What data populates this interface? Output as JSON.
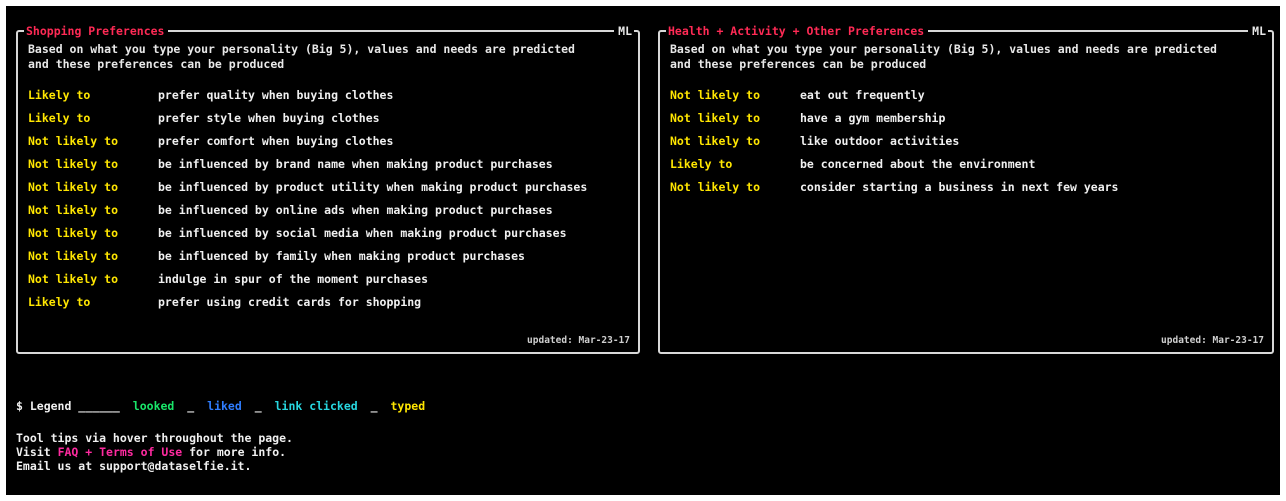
{
  "panels": {
    "shopping": {
      "title": "Shopping Preferences",
      "badge": "ML",
      "desc_line1": "Based on what you type your personality (Big 5), values and needs are predicted",
      "desc_line2": "and these preferences can be produced",
      "rows": [
        {
          "likelihood": "Likely to",
          "text": "prefer quality when buying clothes"
        },
        {
          "likelihood": "Likely to",
          "text": "prefer style when buying clothes"
        },
        {
          "likelihood": "Not likely to",
          "text": "prefer comfort when buying clothes"
        },
        {
          "likelihood": "Not likely to",
          "text": "be influenced by brand name when making product purchases"
        },
        {
          "likelihood": "Not likely to",
          "text": "be influenced by product utility when making product purchases"
        },
        {
          "likelihood": "Not likely to",
          "text": "be influenced by online ads when making product purchases"
        },
        {
          "likelihood": "Not likely to",
          "text": "be influenced by social media when making product purchases"
        },
        {
          "likelihood": "Not likely to",
          "text": "be influenced by family when making product purchases"
        },
        {
          "likelihood": "Not likely to",
          "text": "indulge in spur of the moment purchases"
        },
        {
          "likelihood": "Likely to",
          "text": "prefer using credit cards for shopping"
        }
      ],
      "updated": "updated: Mar-23-17"
    },
    "health": {
      "title": "Health + Activity + Other Preferences",
      "badge": "ML",
      "desc_line1": "Based on what you type your personality (Big 5), values and needs are predicted",
      "desc_line2": "and these preferences can be produced",
      "rows": [
        {
          "likelihood": "Not likely to",
          "text": "eat out frequently"
        },
        {
          "likelihood": "Not likely to",
          "text": "have a gym membership"
        },
        {
          "likelihood": "Not likely to",
          "text": "like outdoor activities"
        },
        {
          "likelihood": "Likely to",
          "text": "be concerned about the environment"
        },
        {
          "likelihood": "Not likely to",
          "text": "consider starting a business in next few years"
        }
      ],
      "updated": "updated: Mar-23-17"
    }
  },
  "legend": {
    "prefix": "$ Legend ______",
    "looked": "looked",
    "sep1": "_",
    "liked": "liked",
    "sep2": "_",
    "link_clicked": "link clicked",
    "sep3": "_",
    "typed": "typed"
  },
  "footer": {
    "line1": "Tool tips via hover throughout the page.",
    "visit": "Visit",
    "faq_link": "FAQ + Terms of Use",
    "visit_suffix": "for more info.",
    "email": "Email us at support@dataselfie.it."
  },
  "colors": {
    "title": "#ff2a55",
    "likelihood": "#ffe600",
    "looked": "#19e66a",
    "liked": "#2f7dff",
    "link_clicked": "#27d7e0",
    "typed": "#ffe600",
    "link": "#ff2aa0"
  }
}
